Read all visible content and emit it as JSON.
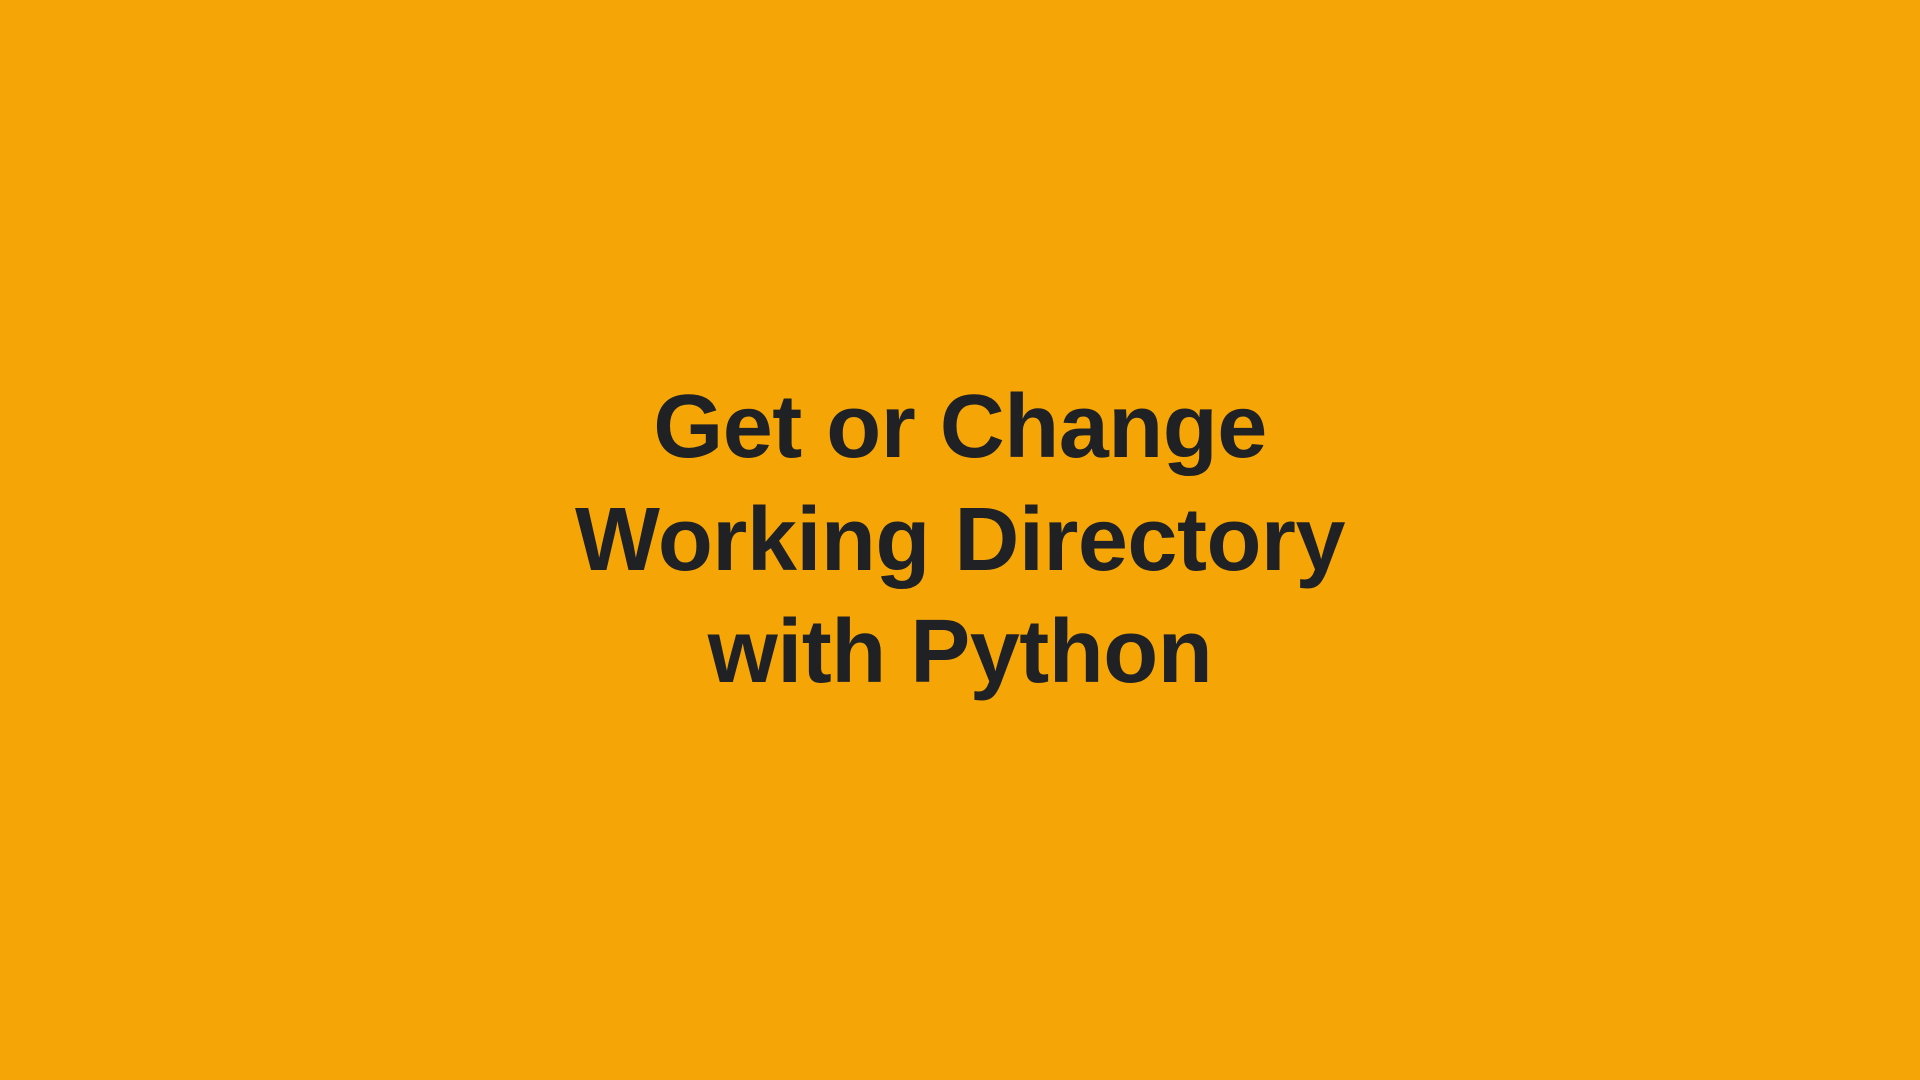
{
  "title": {
    "line1": "Get or Change",
    "line2": "Working Directory",
    "line3": "with Python"
  },
  "colors": {
    "background": "#f5a506",
    "text": "#1f2125"
  }
}
